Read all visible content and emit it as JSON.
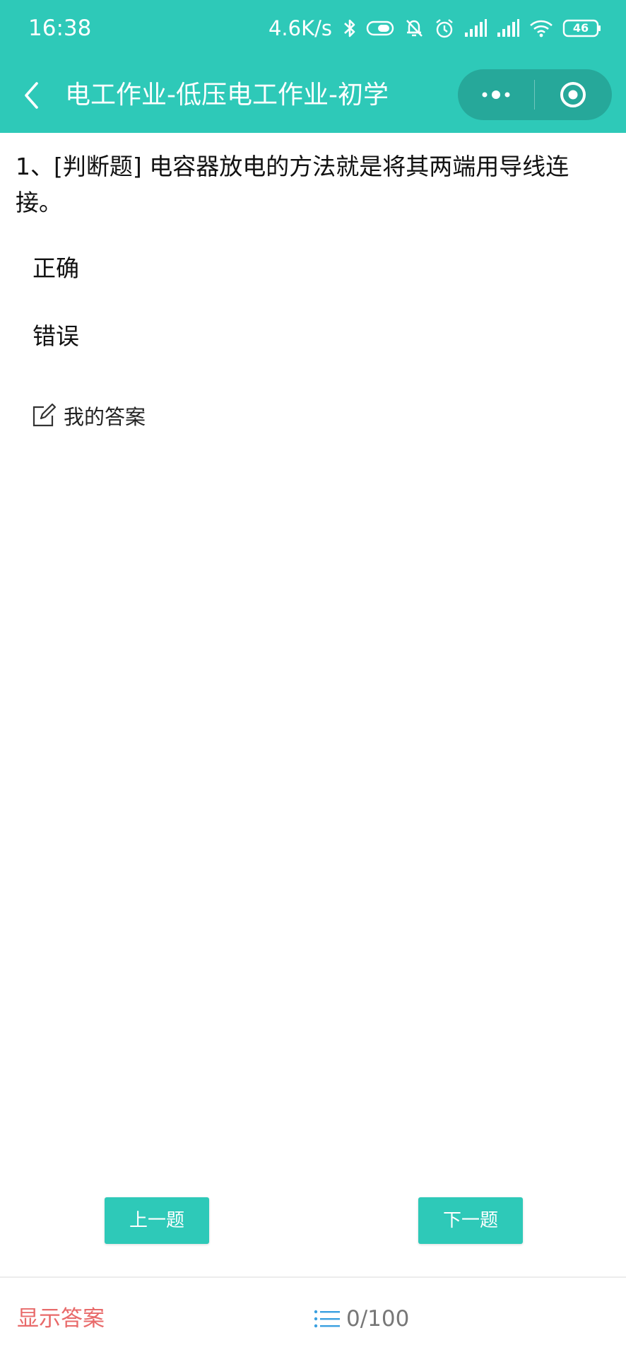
{
  "status_bar": {
    "time": "16:38",
    "net_speed": "4.6K/s",
    "battery": "46",
    "icons": [
      "bluetooth-icon",
      "toggle-icon",
      "mute-icon",
      "alarm-icon",
      "signal-icon",
      "signal-icon",
      "wifi-icon",
      "battery-icon"
    ]
  },
  "header": {
    "title": "电工作业-低压电工作业-初学",
    "back_icon": "back-arrow-icon",
    "more_icon": "more-dots-icon",
    "close_icon": "target-close-icon"
  },
  "question": {
    "text": "1、[判断题] 电容器放电的方法就是将其两端用导线连接。",
    "options": [
      "正确",
      "错误"
    ]
  },
  "my_answer": {
    "icon": "edit-icon",
    "label": "我的答案"
  },
  "navigation": {
    "prev_label": "上一题",
    "next_label": "下一题"
  },
  "footer": {
    "show_answer_label": "显示答案",
    "progress_icon": "list-icon",
    "progress_text": "0/100"
  },
  "colors": {
    "accent": "#2ec9b8",
    "show_answer": "#e86a6a",
    "progress_text": "#777777",
    "list_icon": "#3aa0e0"
  }
}
